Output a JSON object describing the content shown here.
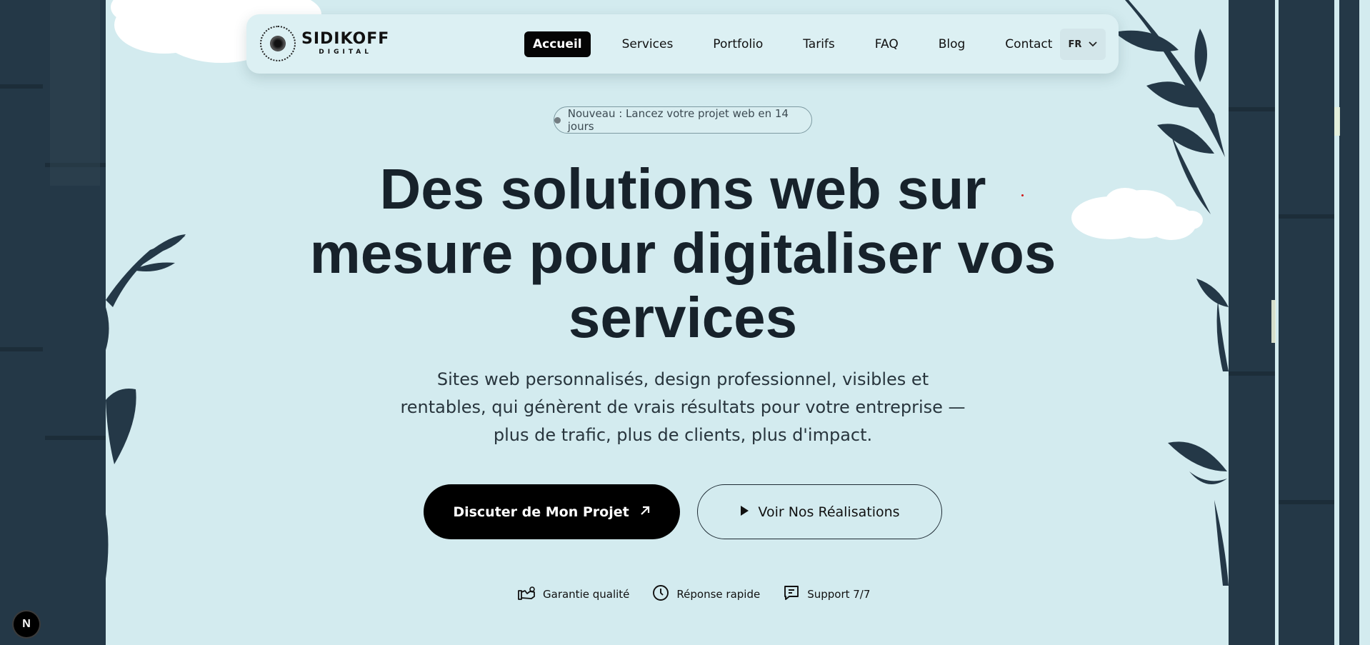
{
  "brand": {
    "name": "SIDIKOFF",
    "tagline": "DIGITAL",
    "logo_ring_text": "SIDIKOFF DIGITAL"
  },
  "nav": {
    "items": [
      {
        "label": "Accueil",
        "active": true
      },
      {
        "label": "Services",
        "active": false
      },
      {
        "label": "Portfolio",
        "active": false
      },
      {
        "label": "Tarifs",
        "active": false
      },
      {
        "label": "FAQ",
        "active": false
      },
      {
        "label": "Blog",
        "active": false
      },
      {
        "label": "Contact",
        "active": false
      }
    ],
    "language": "FR"
  },
  "hero": {
    "badge": "Nouveau : Lancez votre projet web en 14 jours",
    "title_lines": [
      "Des solutions web sur",
      "mesure pour digitaliser vos",
      "services"
    ],
    "subtitle_lines": [
      "Sites web personnalisés, design professionnel, visibles et",
      "rentables, qui génèrent de vrais résultats pour votre entreprise —",
      "plus de trafic, plus de clients, plus d'impact."
    ],
    "cta_primary": "Discuter de Mon Projet",
    "cta_secondary": "Voir Nos Réalisations",
    "features": [
      {
        "icon": "quality-icon",
        "label": "Garantie qualité"
      },
      {
        "icon": "clock-icon",
        "label": "Réponse rapide"
      },
      {
        "icon": "chat-icon",
        "label": "Support 7/7"
      }
    ]
  },
  "dev_badge": "N",
  "colors": {
    "background": "#d3ebef",
    "foliage": "#243847",
    "text": "#17222b",
    "button": "#000000"
  }
}
